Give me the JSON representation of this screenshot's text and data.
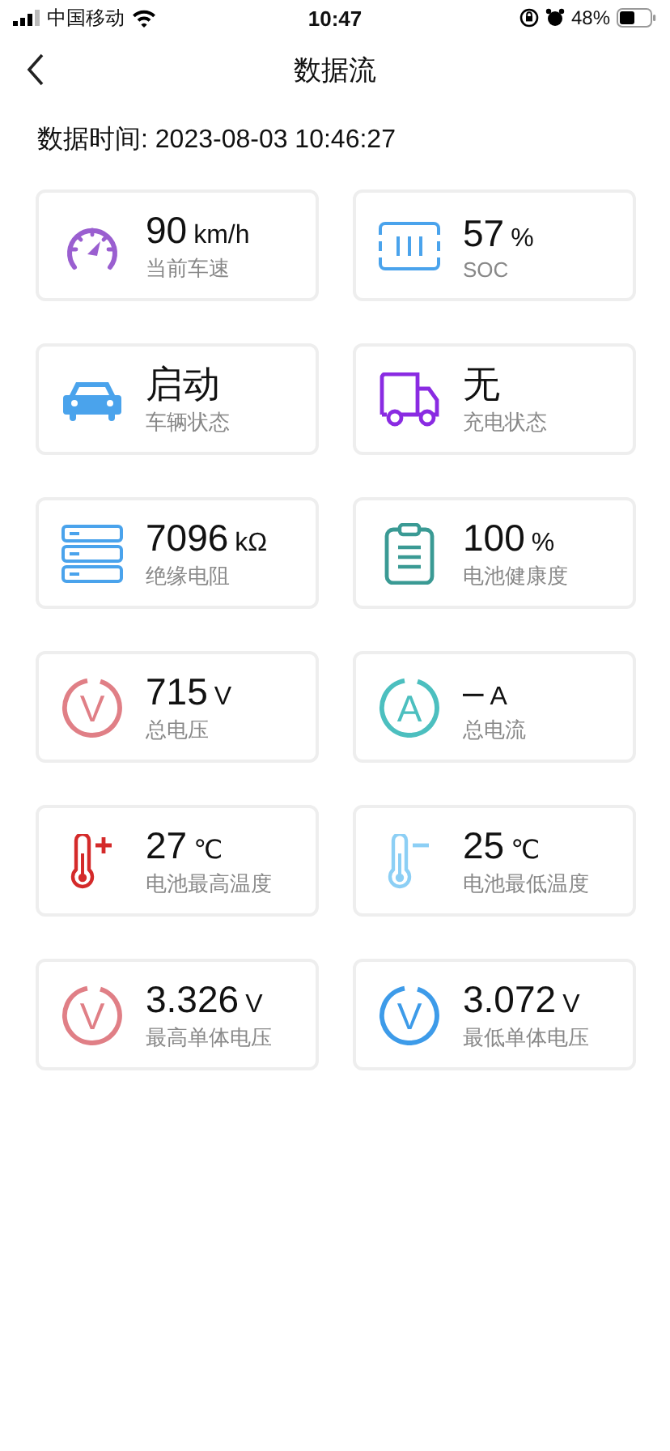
{
  "status_bar": {
    "carrier": "中国移动",
    "time": "10:47",
    "battery": "48%"
  },
  "nav": {
    "title": "数据流"
  },
  "data_time": "数据时间: 2023-08-03 10:46:27",
  "cards": [
    {
      "kind": "speedometer",
      "color": "#9a5fd0",
      "value": "90",
      "unit": "km/h",
      "label": "当前车速"
    },
    {
      "kind": "battery",
      "color": "#4aa3ec",
      "value": "57",
      "unit": "%",
      "label": "SOC"
    },
    {
      "kind": "car",
      "color": "#4aa3ec",
      "value": "启动",
      "label": "车辆状态"
    },
    {
      "kind": "truck",
      "color": "#8a2be2",
      "value": "无",
      "label": "充电状态"
    },
    {
      "kind": "server",
      "color": "#4aa3ec",
      "value": "7096",
      "unit": "kΩ",
      "label": "绝缘电阻"
    },
    {
      "kind": "clipboard",
      "color": "#3a9a94",
      "value": "100",
      "unit": "%",
      "label": "电池健康度"
    },
    {
      "kind": "letter-circle",
      "symbol": "V",
      "color": "#e07f86",
      "value": "715",
      "unit": "V",
      "label": "总电压"
    },
    {
      "kind": "letter-circle",
      "symbol": "A",
      "color": "#4cbfbf",
      "value": "–",
      "unit": "A",
      "label": "总电流"
    },
    {
      "kind": "thermo-plus",
      "color": "#d42a2a",
      "value": "27",
      "unit": "℃",
      "label": "电池最高温度"
    },
    {
      "kind": "thermo-minus",
      "color": "#8ccff5",
      "value": "25",
      "unit": "℃",
      "label": "电池最低温度"
    },
    {
      "kind": "letter-circle",
      "symbol": "V",
      "color": "#e07f86",
      "value": "3.326",
      "unit": "V",
      "label": "最高单体电压"
    },
    {
      "kind": "letter-circle",
      "symbol": "V",
      "color": "#3d9be9",
      "value": "3.072",
      "unit": "V",
      "label": "最低单体电压"
    }
  ]
}
